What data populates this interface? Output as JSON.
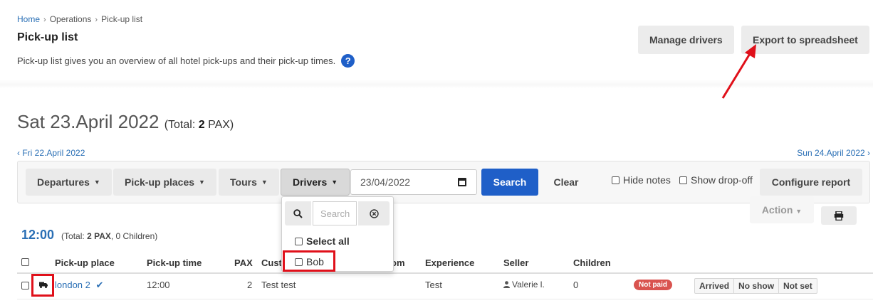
{
  "breadcrumb": [
    "Home",
    "Operations",
    "Pick-up list"
  ],
  "breadcrumb_sep": "›",
  "page": {
    "title": "Pick-up list",
    "description": "Pick-up list gives you an overview of all hotel pick-ups and their pick-up times.",
    "help": "?"
  },
  "header_buttons": {
    "manage_drivers": "Manage drivers",
    "export": "Export to spreadsheet"
  },
  "date_heading": {
    "date": "Sat 23.April 2022",
    "total_prefix": "(Total:",
    "total_value": "2",
    "total_suffix": "PAX)"
  },
  "nav": {
    "prev": "‹ Fri 22.April 2022",
    "next": "Sun 24.April 2022 ›"
  },
  "toolbar": {
    "departures": "Departures",
    "pickup_places": "Pick-up places",
    "tours": "Tours",
    "drivers": "Drivers",
    "date_value": "23/04/2022",
    "search": "Search",
    "clear": "Clear",
    "hide_notes": "Hide notes",
    "show_dropoff": "Show drop-off",
    "configure": "Configure report",
    "caret": "▼"
  },
  "action": {
    "label": "Action",
    "caret": "▼"
  },
  "drivers_dropdown": {
    "search_placeholder": "Search",
    "select_all": "Select all",
    "items": [
      "Bob"
    ]
  },
  "time_group": {
    "time": "12:00",
    "summary_prefix": "(Total:",
    "summary_pax": "2 PAX",
    "summary_suffix": ", 0 Children)"
  },
  "table": {
    "headers": [
      "Pick-up place",
      "Pick-up time",
      "PAX",
      "Cust",
      "om",
      "Experience",
      "Seller",
      "Children"
    ],
    "rows": [
      {
        "pickup_place": "london 2",
        "check": "✔",
        "pickup_time": "12:00",
        "pax": "2",
        "customer": "Test test",
        "experience": "Test",
        "seller": "Valerie l.",
        "children": "0",
        "status": "Not paid",
        "actions": [
          "Arrived",
          "No show",
          "Not set"
        ]
      }
    ]
  },
  "colors": {
    "link": "#2a6fb5",
    "primary": "#1f5fc8",
    "danger": "#d9534f",
    "annotation": "#e0101a"
  }
}
